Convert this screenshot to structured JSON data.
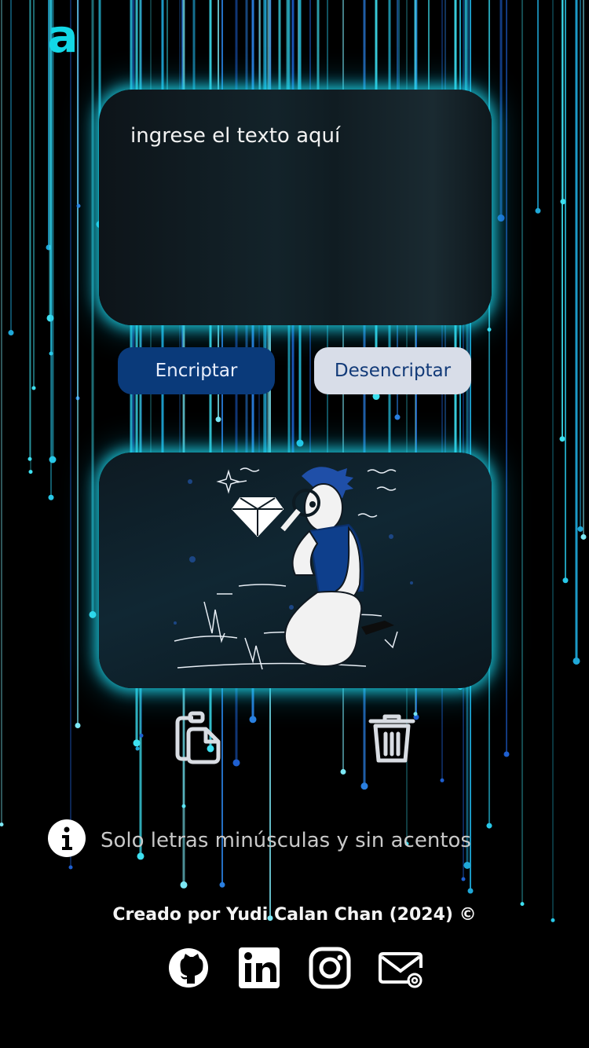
{
  "logo": {
    "glyph": "a",
    "color": "#12d8e6"
  },
  "input": {
    "placeholder": "ingrese el texto aquí",
    "value": ""
  },
  "buttons": {
    "encrypt": "Encriptar",
    "decrypt": "Desencriptar"
  },
  "output": {
    "illustration": "person-searching-with-magnifier"
  },
  "actions": {
    "copy_icon": "clipboard-copy-icon",
    "delete_icon": "trash-icon"
  },
  "info": {
    "icon": "info-icon",
    "text": "Solo letras minúsculas y sin acentos"
  },
  "footer": {
    "credit": "Creado por Yudi Calan Chan (2024) ©",
    "social": [
      "github-icon",
      "linkedin-icon",
      "instagram-icon",
      "mail-icon"
    ]
  },
  "colors": {
    "accent": "#12d8e6",
    "primary_button": "#0a3a7a",
    "secondary_button": "#d8dde8",
    "background": "#000000"
  }
}
